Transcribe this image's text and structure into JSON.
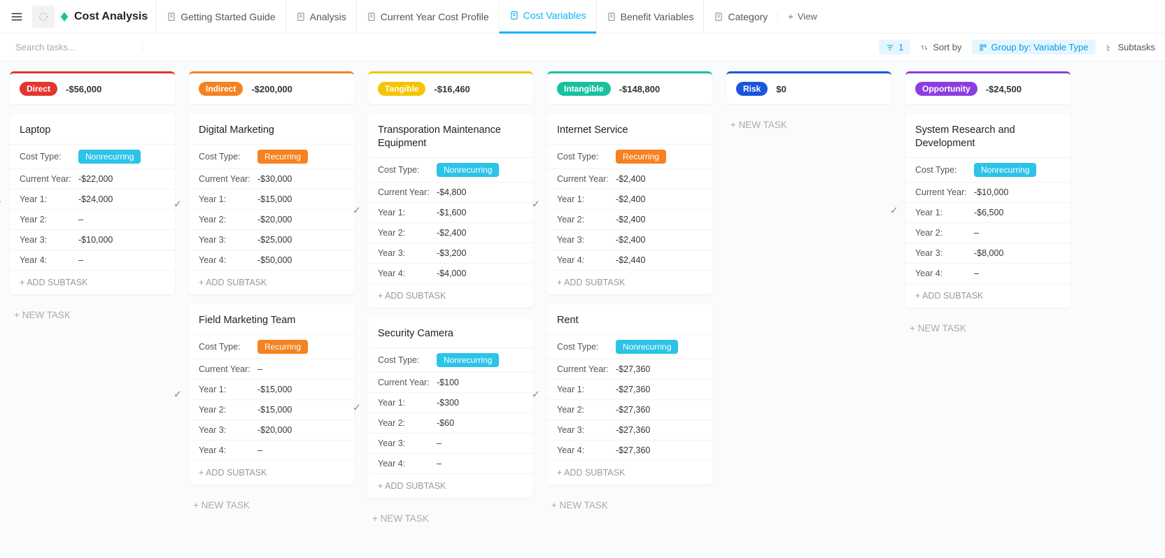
{
  "brand": {
    "title": "Cost Analysis"
  },
  "tabs": [
    {
      "label": "Getting Started Guide",
      "active": false
    },
    {
      "label": "Analysis",
      "active": false
    },
    {
      "label": "Current Year Cost Profile",
      "active": false
    },
    {
      "label": "Cost Variables",
      "active": true
    },
    {
      "label": "Benefit Variables",
      "active": false
    },
    {
      "label": "Category",
      "active": false
    }
  ],
  "view_add_label": "View",
  "search": {
    "placeholder": "Search tasks..."
  },
  "toolbar": {
    "filter_count": "1",
    "sort_label": "Sort by",
    "group_label": "Group by: Variable Type",
    "subtasks_label": "Subtasks"
  },
  "field_labels": {
    "cost_type": "Cost Type:",
    "current_year": "Current Year:",
    "year1": "Year 1:",
    "year2": "Year 2:",
    "year3": "Year 3:",
    "year4": "Year 4:"
  },
  "actions": {
    "add_subtask": "+ ADD SUBTASK",
    "new_task": "+ NEW TASK"
  },
  "columns": [
    {
      "name": "Direct",
      "amount": "-$56,000",
      "badge_bg": "#e3362e",
      "accent": "accent-red",
      "cards": [
        {
          "title": "Laptop",
          "cost_type": "Nonrecurring",
          "current_year": "-$22,000",
          "year1": "-$24,000",
          "year2": "–",
          "year3": "-$10,000",
          "year4": "–"
        }
      ]
    },
    {
      "name": "Indirect",
      "amount": "-$200,000",
      "badge_bg": "#f58220",
      "accent": "accent-orange",
      "cards": [
        {
          "title": "Digital Marketing",
          "cost_type": "Recurring",
          "current_year": "-$30,000",
          "year1": "-$15,000",
          "year2": "-$20,000",
          "year3": "-$25,000",
          "year4": "-$50,000"
        },
        {
          "title": "Field Marketing Team",
          "cost_type": "Recurring",
          "current_year": "–",
          "year1": "-$15,000",
          "year2": "-$15,000",
          "year3": "-$20,000",
          "year4": "–"
        }
      ]
    },
    {
      "name": "Tangible",
      "amount": "-$16,460",
      "badge_bg": "#f5c400",
      "accent": "accent-yellow",
      "cards": [
        {
          "title": "Transporation Maintenance Equipment",
          "cost_type": "Nonrecurring",
          "current_year": "-$4,800",
          "year1": "-$1,600",
          "year2": "-$2,400",
          "year3": "-$3,200",
          "year4": "-$4,000"
        },
        {
          "title": "Security Camera",
          "cost_type": "Nonrecurring",
          "current_year": "-$100",
          "year1": "-$300",
          "year2": "-$60",
          "year3": "–",
          "year4": "–"
        }
      ]
    },
    {
      "name": "Intangible",
      "amount": "-$148,800",
      "badge_bg": "#18c19f",
      "accent": "accent-teal",
      "cards": [
        {
          "title": "Internet Service",
          "cost_type": "Recurring",
          "current_year": "-$2,400",
          "year1": "-$2,400",
          "year2": "-$2,400",
          "year3": "-$2,400",
          "year4": "-$2,440"
        },
        {
          "title": "Rent",
          "cost_type": "Nonrecurring",
          "current_year": "-$27,360",
          "year1": "-$27,360",
          "year2": "-$27,360",
          "year3": "-$27,360",
          "year4": "-$27,360"
        }
      ]
    },
    {
      "name": "Risk",
      "amount": "$0",
      "badge_bg": "#1a56db",
      "accent": "accent-blue",
      "cards": []
    },
    {
      "name": "Opportunity",
      "amount": "-$24,500",
      "badge_bg": "#8c3ee0",
      "accent": "accent-purple",
      "cards": [
        {
          "title": "System Research and Development",
          "cost_type": "Nonrecurring",
          "current_year": "-$10,000",
          "year1": "-$6,500",
          "year2": "–",
          "year3": "-$8,000",
          "year4": "–"
        }
      ]
    }
  ]
}
